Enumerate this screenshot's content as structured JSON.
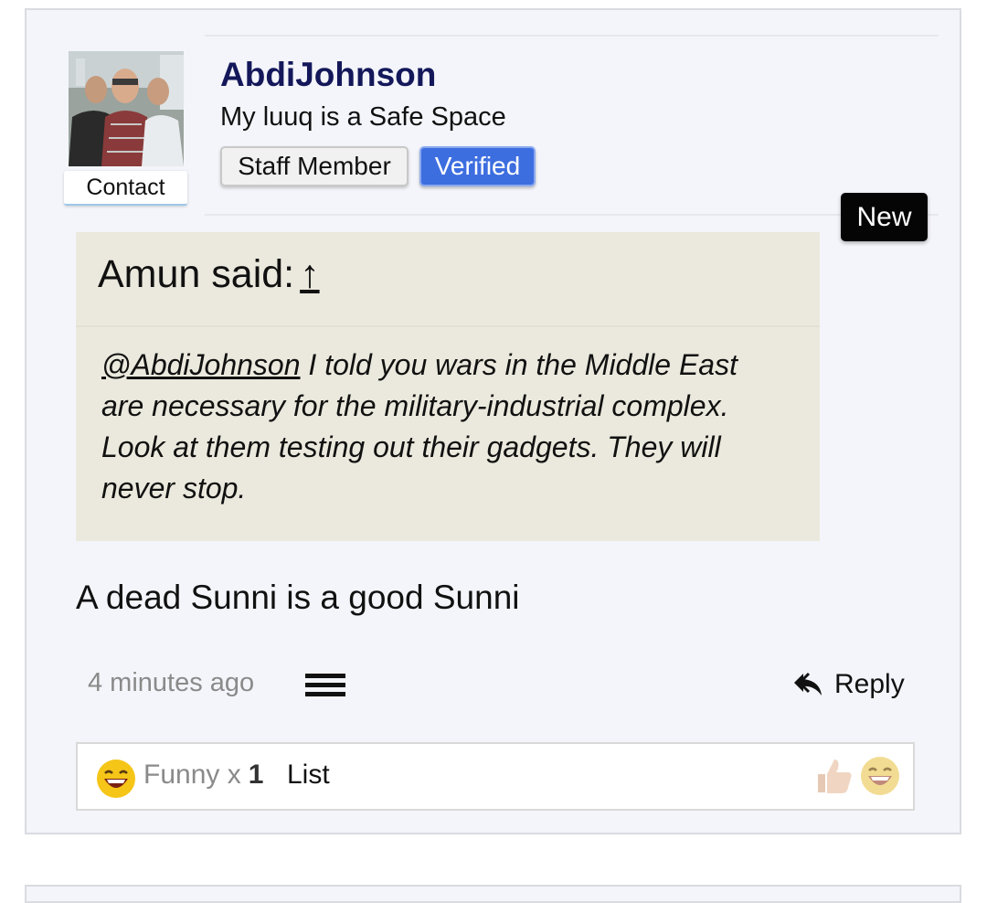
{
  "post": {
    "author": {
      "username": "AbdiJohnson",
      "user_title": "My luuq is a Safe Space",
      "contact_label": "Contact",
      "badges": {
        "staff": "Staff Member",
        "verified": "Verified"
      }
    },
    "new_badge": "New",
    "quote": {
      "author_said": "Amun said:",
      "jump_arrow": "↑",
      "mention": "@AbdiJohnson",
      "text": " I told you wars in the Middle East are necessary for the military-industrial complex. Look at them testing out their gadgets. They will never stop."
    },
    "message": "A dead Sunni is a good Sunni",
    "footer": {
      "timestamp": "4 minutes ago",
      "reply_label": "Reply"
    },
    "reactions": {
      "summary_label": "Funny x",
      "summary_count": "1",
      "list_label": "List"
    }
  },
  "colors": {
    "username": "#14185a",
    "verified_badge": "#3d6ee0",
    "quote_background": "#ebe9dd",
    "post_background": "#f4f5fa"
  }
}
